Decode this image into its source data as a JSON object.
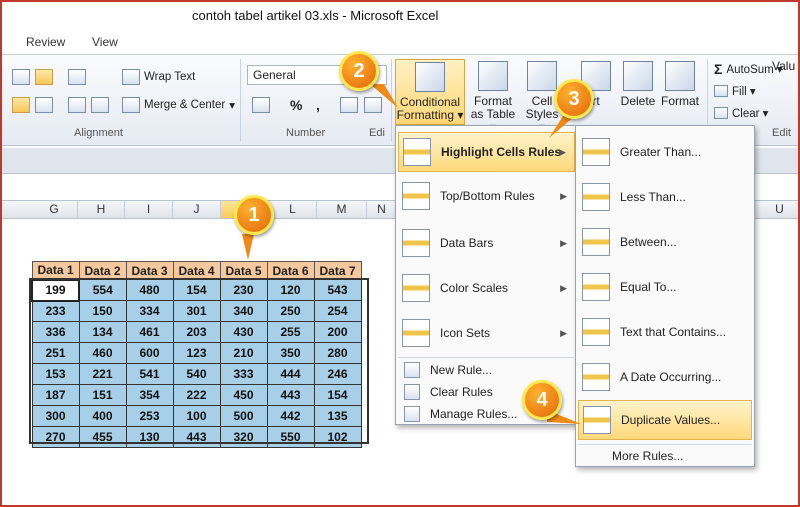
{
  "window": {
    "title": "contoh tabel artikel 03.xls  -  Microsoft Excel"
  },
  "ribbon_tabs": [
    "Review",
    "View"
  ],
  "ribbon": {
    "wrap_text": "Wrap Text",
    "merge_center": "Merge & Center",
    "merge_arrow": "▾",
    "number_format": "General",
    "percent": "%",
    "comma": ",",
    "alignment_label": "Alignment",
    "number_label": "Number",
    "styles_label_partial": "Edi",
    "conditional_formatting": [
      "Conditional",
      "Formatting ▾"
    ],
    "format_as_table": [
      "Format",
      "as Table ▾"
    ],
    "cell_styles": [
      "Cell",
      "Styles ▾"
    ],
    "insert_partial": "rt",
    "delete": "Delete",
    "format": "Format",
    "autosum": "AutoSum ▾",
    "autosum_symbol": "Σ",
    "fill": "Fill ▾",
    "clear": "Clear ▾",
    "edit_label_partial": "Edit",
    "value_partial": "Valu"
  },
  "columns": [
    "G",
    "H",
    "I",
    "J",
    "K",
    "L",
    "M",
    "N",
    "U"
  ],
  "table": {
    "headers": [
      "Data 1",
      "Data 2",
      "Data 3",
      "Data 4",
      "Data 5",
      "Data 6",
      "Data 7"
    ],
    "rows": [
      [
        "199",
        "554",
        "480",
        "154",
        "230",
        "120",
        "543"
      ],
      [
        "233",
        "150",
        "334",
        "301",
        "340",
        "250",
        "254"
      ],
      [
        "336",
        "134",
        "461",
        "203",
        "430",
        "255",
        "200"
      ],
      [
        "251",
        "460",
        "600",
        "123",
        "210",
        "350",
        "280"
      ],
      [
        "153",
        "221",
        "541",
        "540",
        "333",
        "444",
        "246"
      ],
      [
        "187",
        "151",
        "354",
        "222",
        "450",
        "443",
        "154"
      ],
      [
        "300",
        "400",
        "253",
        "100",
        "500",
        "442",
        "135"
      ],
      [
        "270",
        "455",
        "130",
        "443",
        "320",
        "550",
        "102"
      ]
    ]
  },
  "cf_menu": {
    "items": [
      {
        "label": "Highlight Cells Rules",
        "icon": "highlight-cells-icon",
        "submenu": true
      },
      {
        "label": "Top/Bottom Rules",
        "icon": "top-bottom-icon",
        "submenu": true
      },
      {
        "label": "Data Bars",
        "icon": "data-bars-icon",
        "submenu": true
      },
      {
        "label": "Color Scales",
        "icon": "color-scales-icon",
        "submenu": true
      },
      {
        "label": "Icon Sets",
        "icon": "icon-sets-icon",
        "submenu": true
      }
    ],
    "actions": [
      "New Rule...",
      "Clear Rules",
      "Manage Rules..."
    ]
  },
  "highlight_submenu": {
    "items": [
      "Greater Than...",
      "Less Than...",
      "Between...",
      "Equal To...",
      "Text that Contains...",
      "A Date Occurring...",
      "Duplicate Values..."
    ],
    "more": "More Rules..."
  },
  "badges": [
    "1",
    "2",
    "3",
    "4"
  ],
  "colors": {
    "badge": "#f08a16",
    "badge_ring": "#ffe84b",
    "header_fill": "#f5c89d",
    "cell_fill": "#a7cfe8",
    "frame": "#c0392b"
  }
}
